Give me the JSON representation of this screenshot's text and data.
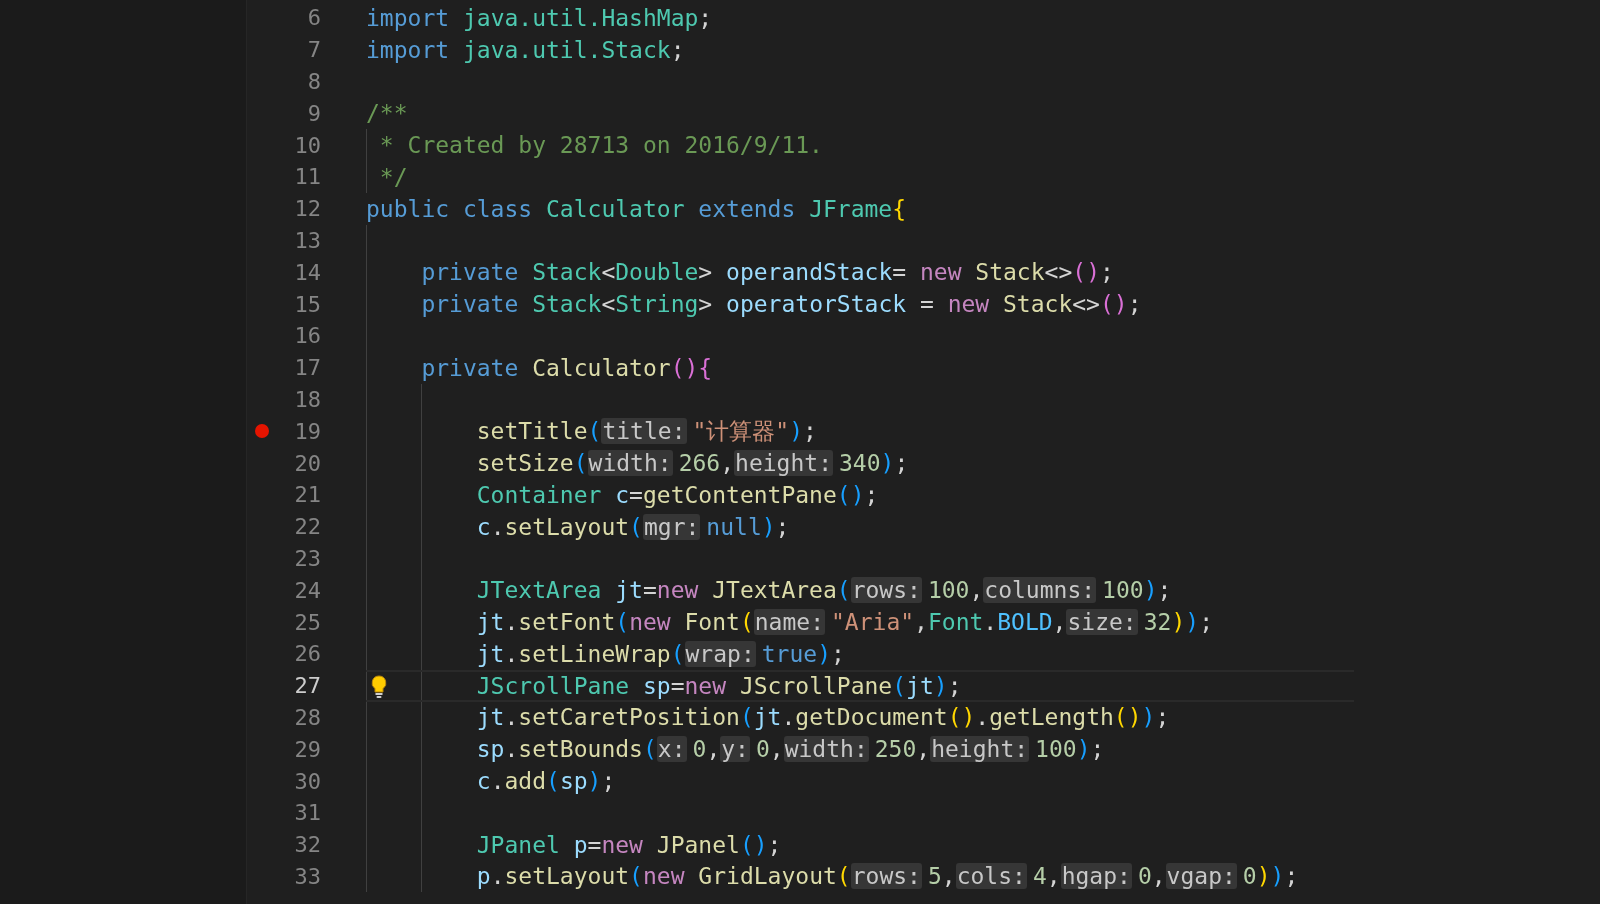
{
  "editor": {
    "lines": [
      {
        "number": "6",
        "breakpoint": false,
        "lightbulb": false,
        "current": false,
        "tokens": [
          {
            "kind": "keyword",
            "text": "import "
          },
          {
            "kind": "package",
            "text": "java.util.HashMap"
          },
          {
            "kind": "plain",
            "text": ";"
          }
        ]
      },
      {
        "number": "7",
        "breakpoint": false,
        "lightbulb": false,
        "current": false,
        "tokens": [
          {
            "kind": "keyword",
            "text": "import "
          },
          {
            "kind": "package",
            "text": "java.util.Stack"
          },
          {
            "kind": "plain",
            "text": ";"
          }
        ]
      },
      {
        "number": "8",
        "breakpoint": false,
        "lightbulb": false,
        "current": false
      },
      {
        "number": "9",
        "breakpoint": false,
        "lightbulb": false,
        "current": false,
        "tokens": [
          {
            "kind": "comment",
            "text": "/**"
          }
        ]
      },
      {
        "number": "10",
        "breakpoint": false,
        "lightbulb": false,
        "current": false,
        "tokens": [
          {
            "kind": "comment",
            "text": " * Created by 28713 on 2016/9/11."
          }
        ]
      },
      {
        "number": "11",
        "breakpoint": false,
        "lightbulb": false,
        "current": false,
        "tokens": [
          {
            "kind": "comment",
            "text": " */"
          }
        ]
      },
      {
        "number": "12",
        "breakpoint": false,
        "lightbulb": false,
        "current": false,
        "tokens": [
          {
            "kind": "keyword",
            "text": "public class "
          },
          {
            "kind": "type",
            "text": "Calculator"
          },
          {
            "kind": "keyword",
            "text": " extends "
          },
          {
            "kind": "type",
            "text": "JFrame"
          },
          {
            "kind": "bracket3",
            "text": "{"
          }
        ]
      },
      {
        "number": "13",
        "breakpoint": false,
        "lightbulb": false,
        "current": false
      },
      {
        "number": "14",
        "breakpoint": false,
        "lightbulb": false,
        "current": false,
        "tokens": [
          {
            "kind": "keyword",
            "text": "    private "
          },
          {
            "kind": "type",
            "text": "Stack"
          },
          {
            "kind": "plain",
            "text": "<"
          },
          {
            "kind": "type",
            "text": "Double"
          },
          {
            "kind": "plain",
            "text": "> "
          },
          {
            "kind": "variable",
            "text": "operandStack"
          },
          {
            "kind": "plain",
            "text": "= "
          },
          {
            "kind": "control",
            "text": "new "
          },
          {
            "kind": "function",
            "text": "Stack"
          },
          {
            "kind": "plain",
            "text": "<>"
          },
          {
            "kind": "bracket2",
            "text": "()"
          },
          {
            "kind": "plain",
            "text": ";"
          }
        ]
      },
      {
        "number": "15",
        "breakpoint": false,
        "lightbulb": false,
        "current": false,
        "tokens": [
          {
            "kind": "keyword",
            "text": "    private "
          },
          {
            "kind": "type",
            "text": "Stack"
          },
          {
            "kind": "plain",
            "text": "<"
          },
          {
            "kind": "type",
            "text": "String"
          },
          {
            "kind": "plain",
            "text": "> "
          },
          {
            "kind": "variable",
            "text": "operatorStack"
          },
          {
            "kind": "plain",
            "text": " = "
          },
          {
            "kind": "control",
            "text": "new "
          },
          {
            "kind": "function",
            "text": "Stack"
          },
          {
            "kind": "plain",
            "text": "<>"
          },
          {
            "kind": "bracket2",
            "text": "()"
          },
          {
            "kind": "plain",
            "text": ";"
          }
        ]
      },
      {
        "number": "16",
        "breakpoint": false,
        "lightbulb": false,
        "current": false
      },
      {
        "number": "17",
        "breakpoint": false,
        "lightbulb": false,
        "current": false,
        "tokens": [
          {
            "kind": "keyword",
            "text": "    private "
          },
          {
            "kind": "function",
            "text": "Calculator"
          },
          {
            "kind": "bracket2",
            "text": "(){"
          }
        ]
      },
      {
        "number": "18",
        "breakpoint": false,
        "lightbulb": false,
        "current": false
      },
      {
        "number": "19",
        "breakpoint": true,
        "lightbulb": false,
        "current": false,
        "tokens": [
          {
            "kind": "function",
            "text": "        setTitle"
          },
          {
            "kind": "bracket1",
            "text": "("
          },
          {
            "kind": "hint",
            "text": "title:"
          },
          {
            "kind": "string",
            "text": "\"计算器\""
          },
          {
            "kind": "bracket1",
            "text": ")"
          },
          {
            "kind": "plain",
            "text": ";"
          }
        ]
      },
      {
        "number": "20",
        "breakpoint": false,
        "lightbulb": false,
        "current": false,
        "tokens": [
          {
            "kind": "function",
            "text": "        setSize"
          },
          {
            "kind": "bracket1",
            "text": "("
          },
          {
            "kind": "hint",
            "text": "width:"
          },
          {
            "kind": "number",
            "text": "266"
          },
          {
            "kind": "plain",
            "text": ","
          },
          {
            "kind": "hint",
            "text": "height:"
          },
          {
            "kind": "number",
            "text": "340"
          },
          {
            "kind": "bracket1",
            "text": ")"
          },
          {
            "kind": "plain",
            "text": ";"
          }
        ]
      },
      {
        "number": "21",
        "breakpoint": false,
        "lightbulb": false,
        "current": false,
        "tokens": [
          {
            "kind": "type",
            "text": "        Container"
          },
          {
            "kind": "variable",
            "text": " c"
          },
          {
            "kind": "plain",
            "text": "="
          },
          {
            "kind": "function",
            "text": "getContentPane"
          },
          {
            "kind": "bracket1",
            "text": "()"
          },
          {
            "kind": "plain",
            "text": ";"
          }
        ]
      },
      {
        "number": "22",
        "breakpoint": false,
        "lightbulb": false,
        "current": false,
        "tokens": [
          {
            "kind": "variable",
            "text": "        c"
          },
          {
            "kind": "plain",
            "text": "."
          },
          {
            "kind": "function",
            "text": "setLayout"
          },
          {
            "kind": "bracket1",
            "text": "("
          },
          {
            "kind": "hint",
            "text": "mgr:"
          },
          {
            "kind": "keyword",
            "text": "null"
          },
          {
            "kind": "bracket1",
            "text": ")"
          },
          {
            "kind": "plain",
            "text": ";"
          }
        ]
      },
      {
        "number": "23",
        "breakpoint": false,
        "lightbulb": false,
        "current": false
      },
      {
        "number": "24",
        "breakpoint": false,
        "lightbulb": false,
        "current": false,
        "tokens": [
          {
            "kind": "type",
            "text": "        JTextArea"
          },
          {
            "kind": "variable",
            "text": " jt"
          },
          {
            "kind": "plain",
            "text": "="
          },
          {
            "kind": "control",
            "text": "new "
          },
          {
            "kind": "function",
            "text": "JTextArea"
          },
          {
            "kind": "bracket1",
            "text": "("
          },
          {
            "kind": "hint",
            "text": "rows:"
          },
          {
            "kind": "number",
            "text": "100"
          },
          {
            "kind": "plain",
            "text": ","
          },
          {
            "kind": "hint",
            "text": "columns:"
          },
          {
            "kind": "number",
            "text": "100"
          },
          {
            "kind": "bracket1",
            "text": ")"
          },
          {
            "kind": "plain",
            "text": ";"
          }
        ]
      },
      {
        "number": "25",
        "breakpoint": false,
        "lightbulb": false,
        "current": false,
        "tokens": [
          {
            "kind": "variable",
            "text": "        jt"
          },
          {
            "kind": "plain",
            "text": "."
          },
          {
            "kind": "function",
            "text": "setFont"
          },
          {
            "kind": "bracket1",
            "text": "("
          },
          {
            "kind": "control",
            "text": "new "
          },
          {
            "kind": "function",
            "text": "Font"
          },
          {
            "kind": "bracket3",
            "text": "("
          },
          {
            "kind": "hint",
            "text": "name:"
          },
          {
            "kind": "string",
            "text": "\"Aria\""
          },
          {
            "kind": "plain",
            "text": ","
          },
          {
            "kind": "type",
            "text": "Font"
          },
          {
            "kind": "plain",
            "text": "."
          },
          {
            "kind": "constant",
            "text": "BOLD"
          },
          {
            "kind": "plain",
            "text": ","
          },
          {
            "kind": "hint",
            "text": "size:"
          },
          {
            "kind": "number",
            "text": "32"
          },
          {
            "kind": "bracket3",
            "text": ")"
          },
          {
            "kind": "bracket1",
            "text": ")"
          },
          {
            "kind": "plain",
            "text": ";"
          }
        ]
      },
      {
        "number": "26",
        "breakpoint": false,
        "lightbulb": false,
        "current": false,
        "tokens": [
          {
            "kind": "variable",
            "text": "        jt"
          },
          {
            "kind": "plain",
            "text": "."
          },
          {
            "kind": "function",
            "text": "setLineWrap"
          },
          {
            "kind": "bracket1",
            "text": "("
          },
          {
            "kind": "hint",
            "text": "wrap:"
          },
          {
            "kind": "keyword",
            "text": "true"
          },
          {
            "kind": "bracket1",
            "text": ")"
          },
          {
            "kind": "plain",
            "text": ";"
          }
        ]
      },
      {
        "number": "27",
        "breakpoint": false,
        "lightbulb": true,
        "current": true,
        "tokens": [
          {
            "kind": "type",
            "text": "        JScrollPane"
          },
          {
            "kind": "variable",
            "text": " sp"
          },
          {
            "kind": "plain",
            "text": "="
          },
          {
            "kind": "control",
            "text": "new "
          },
          {
            "kind": "function",
            "text": "JScrollPane"
          },
          {
            "kind": "bracket1",
            "text": "("
          },
          {
            "kind": "variable",
            "text": "jt"
          },
          {
            "kind": "bracket1",
            "text": ")"
          },
          {
            "kind": "plain",
            "text": ";"
          }
        ]
      },
      {
        "number": "28",
        "breakpoint": false,
        "lightbulb": false,
        "current": false,
        "tokens": [
          {
            "kind": "variable",
            "text": "        jt"
          },
          {
            "kind": "plain",
            "text": "."
          },
          {
            "kind": "function",
            "text": "setCaretPosition"
          },
          {
            "kind": "bracket1",
            "text": "("
          },
          {
            "kind": "variable",
            "text": "jt"
          },
          {
            "kind": "plain",
            "text": "."
          },
          {
            "kind": "function",
            "text": "getDocument"
          },
          {
            "kind": "bracket3",
            "text": "()"
          },
          {
            "kind": "plain",
            "text": "."
          },
          {
            "kind": "function",
            "text": "getLength"
          },
          {
            "kind": "bracket3",
            "text": "()"
          },
          {
            "kind": "bracket1",
            "text": ")"
          },
          {
            "kind": "plain",
            "text": ";"
          }
        ]
      },
      {
        "number": "29",
        "breakpoint": false,
        "lightbulb": false,
        "current": false,
        "tokens": [
          {
            "kind": "variable",
            "text": "        sp"
          },
          {
            "kind": "plain",
            "text": "."
          },
          {
            "kind": "function",
            "text": "setBounds"
          },
          {
            "kind": "bracket1",
            "text": "("
          },
          {
            "kind": "hint",
            "text": "x:"
          },
          {
            "kind": "number",
            "text": "0"
          },
          {
            "kind": "plain",
            "text": ","
          },
          {
            "kind": "hint",
            "text": "y:"
          },
          {
            "kind": "number",
            "text": "0"
          },
          {
            "kind": "plain",
            "text": ","
          },
          {
            "kind": "hint",
            "text": "width:"
          },
          {
            "kind": "number",
            "text": "250"
          },
          {
            "kind": "plain",
            "text": ","
          },
          {
            "kind": "hint",
            "text": "height:"
          },
          {
            "kind": "number",
            "text": "100"
          },
          {
            "kind": "bracket1",
            "text": ")"
          },
          {
            "kind": "plain",
            "text": ";"
          }
        ]
      },
      {
        "number": "30",
        "breakpoint": false,
        "lightbulb": false,
        "current": false,
        "tokens": [
          {
            "kind": "variable",
            "text": "        c"
          },
          {
            "kind": "plain",
            "text": "."
          },
          {
            "kind": "function",
            "text": "add"
          },
          {
            "kind": "bracket1",
            "text": "("
          },
          {
            "kind": "variable",
            "text": "sp"
          },
          {
            "kind": "bracket1",
            "text": ")"
          },
          {
            "kind": "plain",
            "text": ";"
          }
        ]
      },
      {
        "number": "31",
        "breakpoint": false,
        "lightbulb": false,
        "current": false
      },
      {
        "number": "32",
        "breakpoint": false,
        "lightbulb": false,
        "current": false,
        "tokens": [
          {
            "kind": "type",
            "text": "        JPanel"
          },
          {
            "kind": "variable",
            "text": " p"
          },
          {
            "kind": "plain",
            "text": "="
          },
          {
            "kind": "control",
            "text": "new "
          },
          {
            "kind": "function",
            "text": "JPanel"
          },
          {
            "kind": "bracket1",
            "text": "()"
          },
          {
            "kind": "plain",
            "text": ";"
          }
        ]
      },
      {
        "number": "33",
        "breakpoint": false,
        "lightbulb": false,
        "current": false,
        "tokens": [
          {
            "kind": "variable",
            "text": "        p"
          },
          {
            "kind": "plain",
            "text": "."
          },
          {
            "kind": "function",
            "text": "setLayout"
          },
          {
            "kind": "bracket1",
            "text": "("
          },
          {
            "kind": "control",
            "text": "new "
          },
          {
            "kind": "function",
            "text": "GridLayout"
          },
          {
            "kind": "bracket3",
            "text": "("
          },
          {
            "kind": "hint",
            "text": "rows:"
          },
          {
            "kind": "number",
            "text": "5"
          },
          {
            "kind": "plain",
            "text": ","
          },
          {
            "kind": "hint",
            "text": "cols:"
          },
          {
            "kind": "number",
            "text": "4"
          },
          {
            "kind": "plain",
            "text": ","
          },
          {
            "kind": "hint",
            "text": "hgap:"
          },
          {
            "kind": "number",
            "text": "0"
          },
          {
            "kind": "plain",
            "text": ","
          },
          {
            "kind": "hint",
            "text": "vgap:"
          },
          {
            "kind": "number",
            "text": "0"
          },
          {
            "kind": "bracket3",
            "text": ")"
          },
          {
            "kind": "bracket1",
            "text": ")"
          },
          {
            "kind": "plain",
            "text": ";"
          }
        ]
      }
    ]
  }
}
